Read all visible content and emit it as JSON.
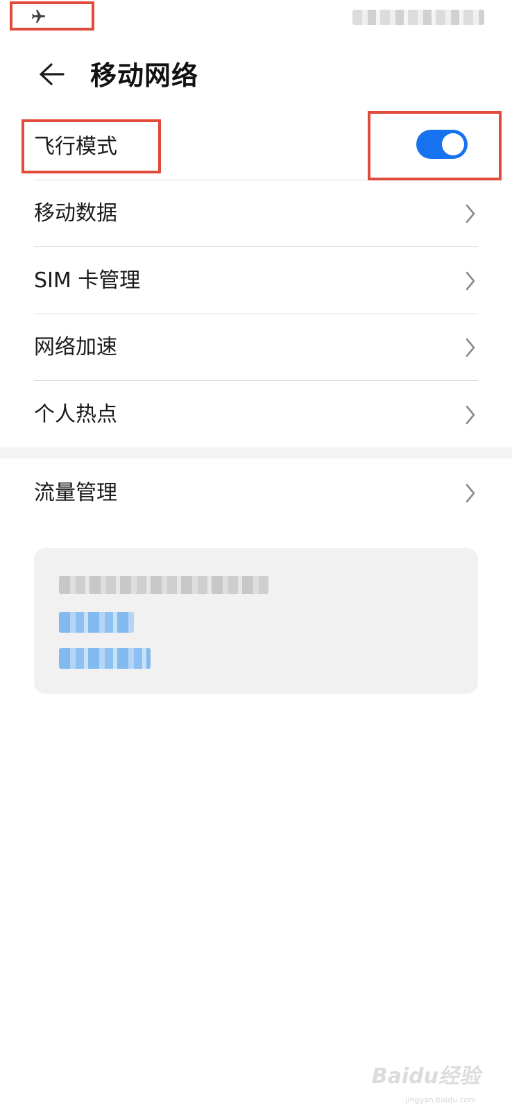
{
  "status_bar": {
    "airplane_icon": "airplane-icon"
  },
  "header": {
    "back_icon": "arrow-left-icon",
    "title": "移动网络"
  },
  "settings": {
    "airplane_mode": {
      "label": "飞行模式",
      "enabled": true,
      "toggle_color": "#1672ee"
    },
    "items": [
      {
        "label": "移动数据",
        "icon": "chevron-right-icon"
      },
      {
        "label": "SIM 卡管理",
        "icon": "chevron-right-icon"
      },
      {
        "label": "网络加速",
        "icon": "chevron-right-icon"
      },
      {
        "label": "个人热点",
        "icon": "chevron-right-icon"
      }
    ],
    "data_management": {
      "label": "流量管理",
      "icon": "chevron-right-icon"
    }
  },
  "annotation_color": "#e04b3c",
  "watermark": {
    "text": "Baidu经验",
    "sub": "jingyan.baidu.com"
  }
}
